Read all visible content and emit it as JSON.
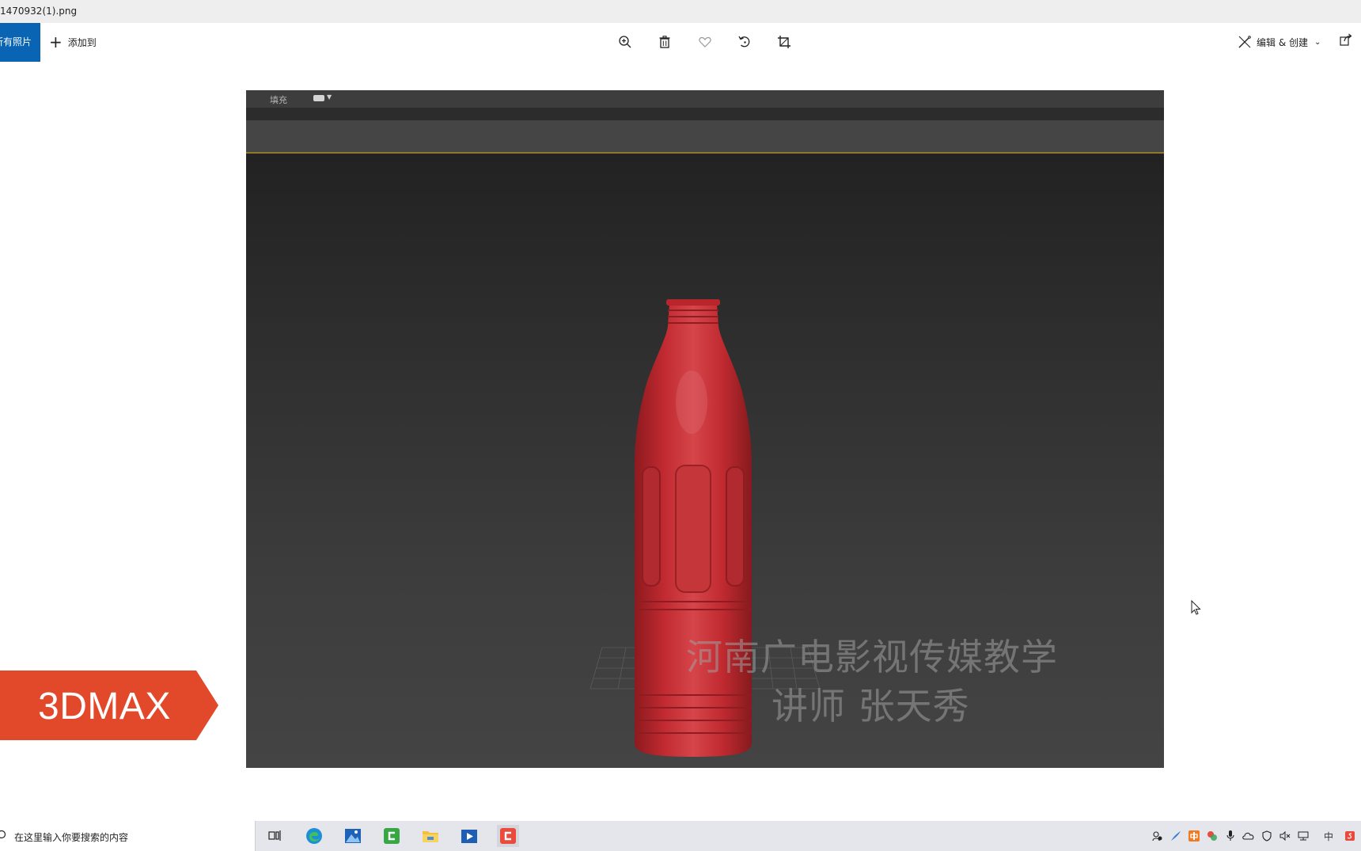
{
  "window": {
    "title": "1470932(1).png"
  },
  "toolbar": {
    "all_photos_label": "所有照片",
    "add_to_label": "添加到",
    "edit_create_label": "编辑 & 创建"
  },
  "viewport": {
    "fill_label": "填充"
  },
  "watermark": {
    "line1": "河南广电影视传媒教学",
    "line2": "讲师 张天秀"
  },
  "badge": {
    "label": "3DMAX",
    "color": "#e2492a"
  },
  "taskbar": {
    "search_placeholder": "在这里输入你要搜索的内容",
    "apps": [
      "task-view",
      "edge",
      "photos",
      "camtasia",
      "file-explorer",
      "media-player",
      "app-c"
    ],
    "tray_ime": "中"
  },
  "colors": {
    "accent": "#0a64b4",
    "bottle": "#c0262c",
    "viewport_bg": "#353535"
  }
}
